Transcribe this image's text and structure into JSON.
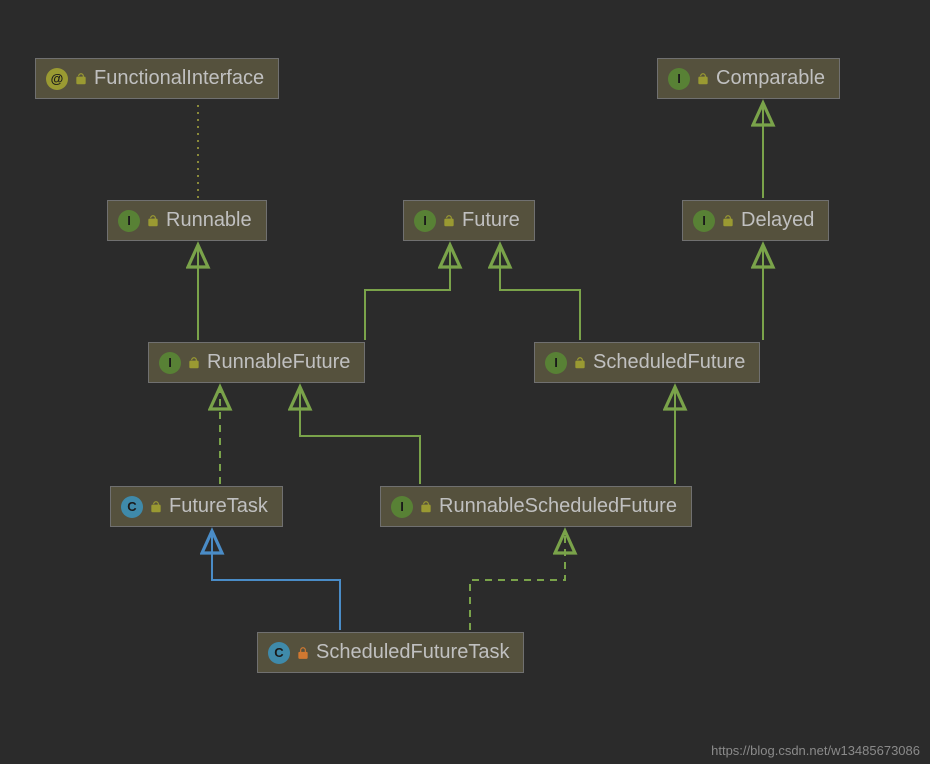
{
  "diagram": {
    "nodes": {
      "functionalInterface": {
        "label": "FunctionalInterface",
        "kind": "@",
        "kindType": "annotation",
        "lock": "open"
      },
      "comparable": {
        "label": "Comparable",
        "kind": "I",
        "kindType": "interface",
        "lock": "open"
      },
      "runnable": {
        "label": "Runnable",
        "kind": "I",
        "kindType": "interface",
        "lock": "open"
      },
      "future": {
        "label": "Future",
        "kind": "I",
        "kindType": "interface",
        "lock": "open"
      },
      "delayed": {
        "label": "Delayed",
        "kind": "I",
        "kindType": "interface",
        "lock": "open"
      },
      "runnableFuture": {
        "label": "RunnableFuture",
        "kind": "I",
        "kindType": "interface",
        "lock": "open"
      },
      "scheduledFuture": {
        "label": "ScheduledFuture",
        "kind": "I",
        "kindType": "interface",
        "lock": "open"
      },
      "futureTask": {
        "label": "FutureTask",
        "kind": "C",
        "kindType": "class",
        "lock": "open"
      },
      "runnableScheduledFuture": {
        "label": "RunnableScheduledFuture",
        "kind": "I",
        "kindType": "interface",
        "lock": "open"
      },
      "scheduledFutureTask": {
        "label": "ScheduledFutureTask",
        "kind": "C",
        "kindType": "class",
        "lock": "closed"
      }
    },
    "edges": [
      {
        "from": "runnable",
        "to": "functionalInterface",
        "style": "dotted",
        "color": "olive"
      },
      {
        "from": "delayed",
        "to": "comparable",
        "style": "solid",
        "color": "green"
      },
      {
        "from": "runnableFuture",
        "to": "runnable",
        "style": "solid",
        "color": "green"
      },
      {
        "from": "runnableFuture",
        "to": "future",
        "style": "solid",
        "color": "green"
      },
      {
        "from": "scheduledFuture",
        "to": "future",
        "style": "solid",
        "color": "green"
      },
      {
        "from": "scheduledFuture",
        "to": "delayed",
        "style": "solid",
        "color": "green"
      },
      {
        "from": "futureTask",
        "to": "runnableFuture",
        "style": "dashed",
        "color": "green"
      },
      {
        "from": "runnableScheduledFuture",
        "to": "runnableFuture",
        "style": "solid",
        "color": "green"
      },
      {
        "from": "runnableScheduledFuture",
        "to": "scheduledFuture",
        "style": "solid",
        "color": "green"
      },
      {
        "from": "scheduledFutureTask",
        "to": "futureTask",
        "style": "solid",
        "color": "blue"
      },
      {
        "from": "scheduledFutureTask",
        "to": "runnableScheduledFuture",
        "style": "dashed",
        "color": "green"
      }
    ],
    "colors": {
      "green": "#7aa34a",
      "blue": "#4a8cc7",
      "olive": "#8a8a3a"
    }
  },
  "watermark": "https://blog.csdn.net/w13485673086"
}
